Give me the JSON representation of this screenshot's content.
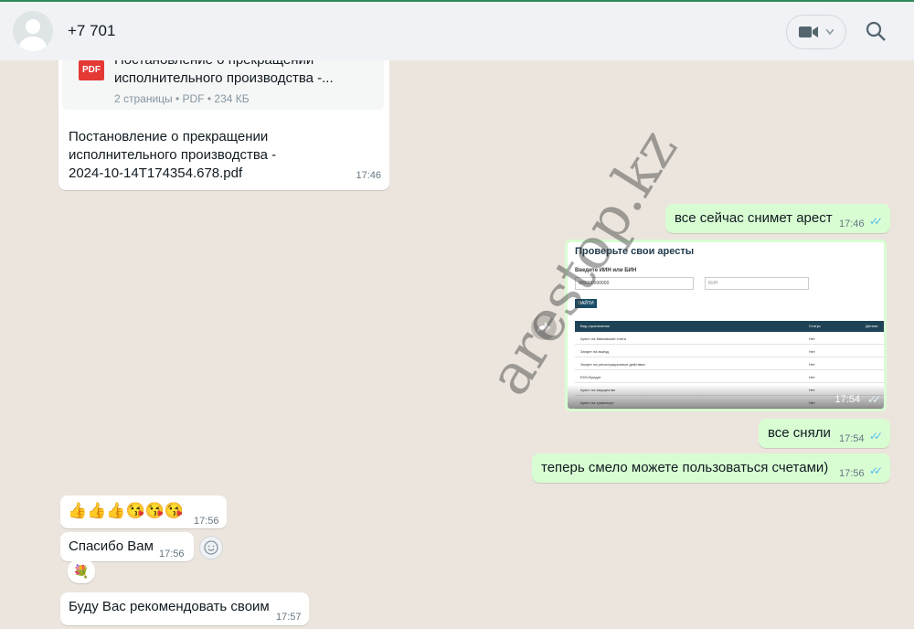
{
  "header": {
    "contact_name": "+7 701",
    "video_icon": "video-camera-icon",
    "dropdown_icon": "chevron-down-icon",
    "search_icon": "search-icon"
  },
  "messages": {
    "doc": {
      "badge": "PDF",
      "title": "Постановление о прекращении исполнительного производства -...",
      "meta": "2 страницы • PDF • 234 КБ",
      "caption_line1": "Постановление о прекращении",
      "caption_line2": "исполнительного производства -",
      "caption_line3": "2024-10-14T174354.678.pdf",
      "time": "17:46"
    },
    "out1": {
      "text": "все сейчас снимет арест",
      "time": "17:46"
    },
    "screenshot": {
      "title": "Проверьте свои аресты",
      "label": "Введите ИИН или БИН",
      "input_value": "900000000000",
      "input2_placeholder": "БИН",
      "button": "НАЙТИ",
      "columns": [
        "Вид ограничения",
        "Статус",
        "Детали"
      ],
      "rows": [
        [
          "Арест на банковские счета",
          "Нет"
        ],
        [
          "Запрет на выезд",
          "Нет"
        ],
        [
          "Запрет на регистрационные действия",
          "Нет"
        ],
        [
          "ЕНС/Кредит",
          "Нет"
        ],
        [
          "Арест на имущество",
          "Нет"
        ],
        [
          "Арест на транспорт",
          "Нет"
        ]
      ],
      "time": "17:54"
    },
    "out2": {
      "text": "все сняли",
      "time": "17:54"
    },
    "out3": {
      "text": "теперь смело можете пользоваться счетами)",
      "time": "17:56"
    },
    "in2": {
      "text": "👍👍👍😘😘😘",
      "time": "17:56"
    },
    "in3": {
      "text": "Спасибо Вам",
      "time": "17:56",
      "reaction": "💐"
    },
    "in4": {
      "text": "Буду Вас рекомендовать своим",
      "time": "17:57"
    }
  },
  "watermark": "arestop.kz",
  "colors": {
    "incoming": "#ffffff",
    "outgoing": "#d9fdd3",
    "ticks": "#53bdeb",
    "chat_bg": "#ece5dd"
  }
}
